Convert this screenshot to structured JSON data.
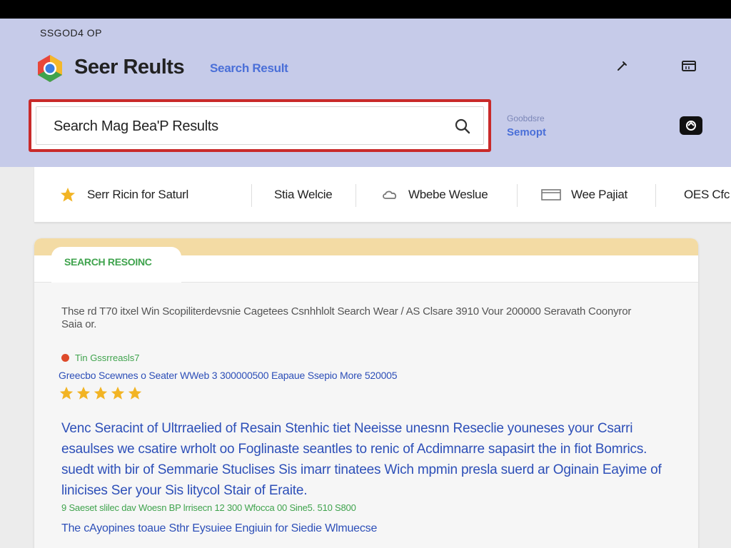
{
  "header": {
    "system_label": "SSGOD4  OP",
    "brand": "Seer Reults",
    "link": "Search Result",
    "icons": {
      "tool": "wrench-icon",
      "window": "window-icon"
    }
  },
  "search": {
    "value": "Search Mag Bea'P Results",
    "icon": "search-icon"
  },
  "side": {
    "sub": "Goobdsre",
    "main": "Semopt",
    "share_icon": "share-icon"
  },
  "tabs": [
    {
      "label": "Serr Ricin for Saturl",
      "icon": "star-icon"
    },
    {
      "label": "Stia Welcie",
      "icon": ""
    },
    {
      "label": "Wbebe Weslue",
      "icon": "cloud-icon"
    },
    {
      "label": "Wee Pajiat",
      "icon": "card-icon"
    },
    {
      "label": "OES Cfc",
      "icon": ""
    }
  ],
  "card": {
    "tab_label": "SEARCH RESOINC",
    "description": "Thse rd T70 itxel Win Scopiliterdevsnie Cagetees Csnhhlolt Search Wear / AS Clsare 3910 Vour 200000 Seravath Coonyror Saia or.",
    "meta": "Tin Gssrreasls7",
    "stats": "Greecbo Scewnes o Seater  WWeb 3  300000500  Eapaue Ssepio More 520005",
    "rating": 5,
    "paragraph": "Venc Seracint of Ultrraelied of Resain Stenhic tiet Neeisse unesnn Reseclie youneses your Csarri esaulses we csatire wrholt oo Foglinaste seantles to renic of Acdimnarre sapasirt the in fiot Bomrics. suedt  with bir of Semmarie Stuclises Sis imarr tinatees Wich mpmin presla suerd ar Oginain  Eayime of linicises Ser your Sis litycol Stair of Eraite.",
    "url": "9 Saeset slilec dav Woesn BP lrrisecn 12 300 Wfocca 00 Sine5. 510 S800",
    "link": "The cAyopines toaue Sthr Eysuiee Engiuin for Siedie Wlmuecse"
  },
  "colors": {
    "header_bg": "#c6cbe9",
    "accent_blue": "#4a6fd8",
    "link_blue": "#2d4fb8",
    "green": "#3fa34d",
    "focus_red": "#c92a2a",
    "star": "#f2b424"
  }
}
